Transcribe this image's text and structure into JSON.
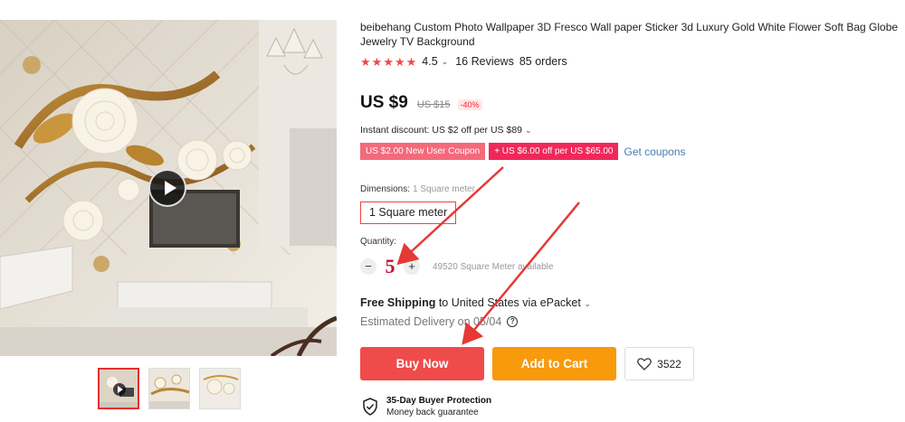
{
  "product": {
    "title": "beibehang Custom Photo Wallpaper 3D Fresco Wall paper Sticker 3d Luxury Gold White Flower Soft Bag Globe Jewelry TV Background",
    "rating": "4.5",
    "reviews": "16 Reviews",
    "orders": "85 orders",
    "price": "US $9",
    "old_price": "US $15",
    "discount": "-40%",
    "instant_discount": "Instant discount: US $2 off per US $89"
  },
  "coupons": {
    "new_user": "US $2.00 New User Coupon",
    "store": "+ US $6.00 off per US $65.00",
    "get": "Get coupons"
  },
  "dimensions": {
    "label": "Dimensions:",
    "selected_hint": "1 Square meter",
    "option": "1 Square meter"
  },
  "quantity": {
    "label": "Quantity:",
    "minus": "−",
    "plus": "+",
    "value": "5",
    "available": "49520 Square Meter available"
  },
  "shipping": {
    "free": "Free Shipping",
    "destination": "to United States via ePacket",
    "delivery": "Estimated Delivery on 05/04"
  },
  "actions": {
    "buy": "Buy Now",
    "cart": "Add to Cart",
    "wishlist_count": "3522"
  },
  "protection": {
    "title": "35-Day Buyer Protection",
    "subtitle": "Money back guarantee"
  },
  "icons": {
    "star": "star-icon",
    "play": "play-icon",
    "heart": "heart-icon",
    "shield": "shield-check-icon",
    "help": "help-icon"
  },
  "colors": {
    "accent_red": "#f04b4b",
    "accent_orange": "#f79a0c",
    "annotation_red": "#e53935",
    "quantity_red": "#c8102e"
  }
}
